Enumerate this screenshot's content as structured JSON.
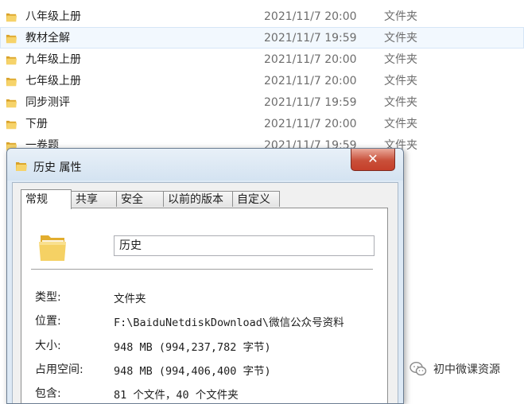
{
  "file_list": [
    {
      "name": "八年级上册",
      "date": "2021/11/7 20:00",
      "type": "文件夹",
      "selected": false
    },
    {
      "name": "教材全解",
      "date": "2021/11/7 19:59",
      "type": "文件夹",
      "selected": true
    },
    {
      "name": "九年级上册",
      "date": "2021/11/7 20:00",
      "type": "文件夹",
      "selected": false
    },
    {
      "name": "七年级上册",
      "date": "2021/11/7 20:00",
      "type": "文件夹",
      "selected": false
    },
    {
      "name": "同步测评",
      "date": "2021/11/7 19:59",
      "type": "文件夹",
      "selected": false
    },
    {
      "name": "下册",
      "date": "2021/11/7 20:00",
      "type": "文件夹",
      "selected": false
    },
    {
      "name": "一卷题",
      "date": "2021/11/7 19:59",
      "type": "文件夹",
      "selected": false
    }
  ],
  "dialog": {
    "title": "历史 属性",
    "close_label": "✕",
    "tabs": [
      {
        "label": "常规",
        "active": true
      },
      {
        "label": "共享",
        "active": false
      },
      {
        "label": "安全",
        "active": false
      },
      {
        "label": "以前的版本",
        "active": false
      },
      {
        "label": "自定义",
        "active": false
      }
    ],
    "folder_name": "历史",
    "properties": [
      {
        "label": "类型:",
        "value": "文件夹"
      },
      {
        "label": "位置:",
        "value": "F:\\BaiduNetdiskDownload\\微信公众号资料"
      },
      {
        "label": "大小:",
        "value": "948 MB (994,237,782 字节)"
      },
      {
        "label": "占用空间:",
        "value": "948 MB (994,406,400 字节)"
      },
      {
        "label": "包含:",
        "value": "81 个文件，40 个文件夹"
      }
    ]
  },
  "watermark": {
    "text": "初中微课资源",
    "icon": "wechat-icon"
  },
  "colors": {
    "selection_bg": "#f2f8fe",
    "close_red": "#c9503a",
    "folder_yellow": "#f3c94a"
  }
}
